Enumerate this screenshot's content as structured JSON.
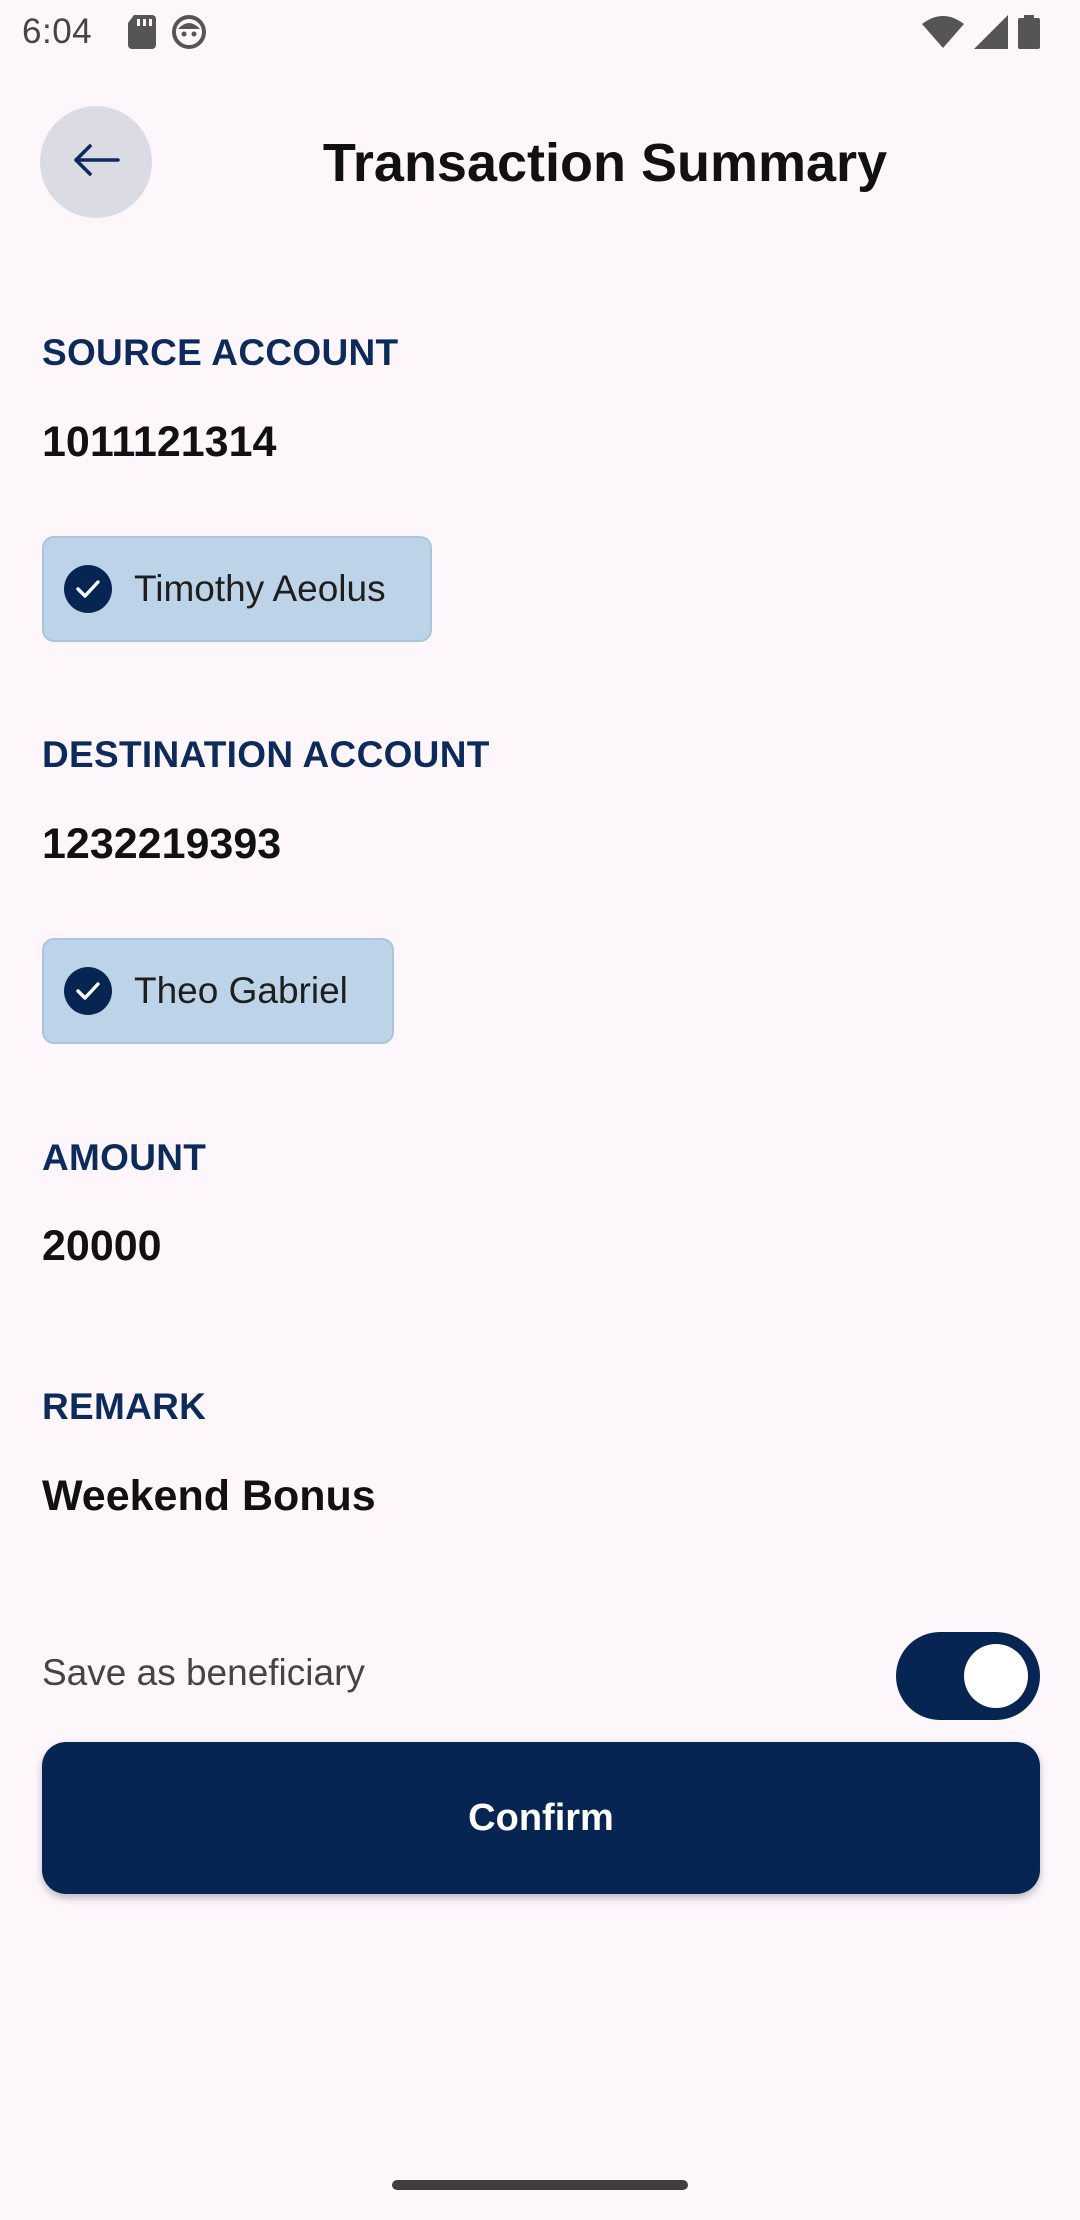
{
  "status_bar": {
    "time": "6:04",
    "left_icons": [
      "sd-card-icon",
      "android-face-icon"
    ],
    "right_icons": [
      "wifi-icon",
      "signal-icon",
      "battery-icon"
    ]
  },
  "header": {
    "back_icon": "arrow-left-icon",
    "title": "Transaction Summary"
  },
  "source": {
    "label": "SOURCE ACCOUNT",
    "account_number": "1011121314",
    "account_name": "Timothy Aeolus"
  },
  "destination": {
    "label": "DESTINATION ACCOUNT",
    "account_number": "1232219393",
    "account_name": "Theo Gabriel"
  },
  "amount": {
    "label": "AMOUNT",
    "value": "20000"
  },
  "remark": {
    "label": "REMARK",
    "value": "Weekend Bonus"
  },
  "save_beneficiary": {
    "label": "Save as beneficiary",
    "enabled": true
  },
  "actions": {
    "confirm_label": "Confirm"
  },
  "colors": {
    "background": "#fdf7fc",
    "primary": "#062552",
    "section_label": "#0c2b5b",
    "chip_background": "#bdd4e8"
  }
}
